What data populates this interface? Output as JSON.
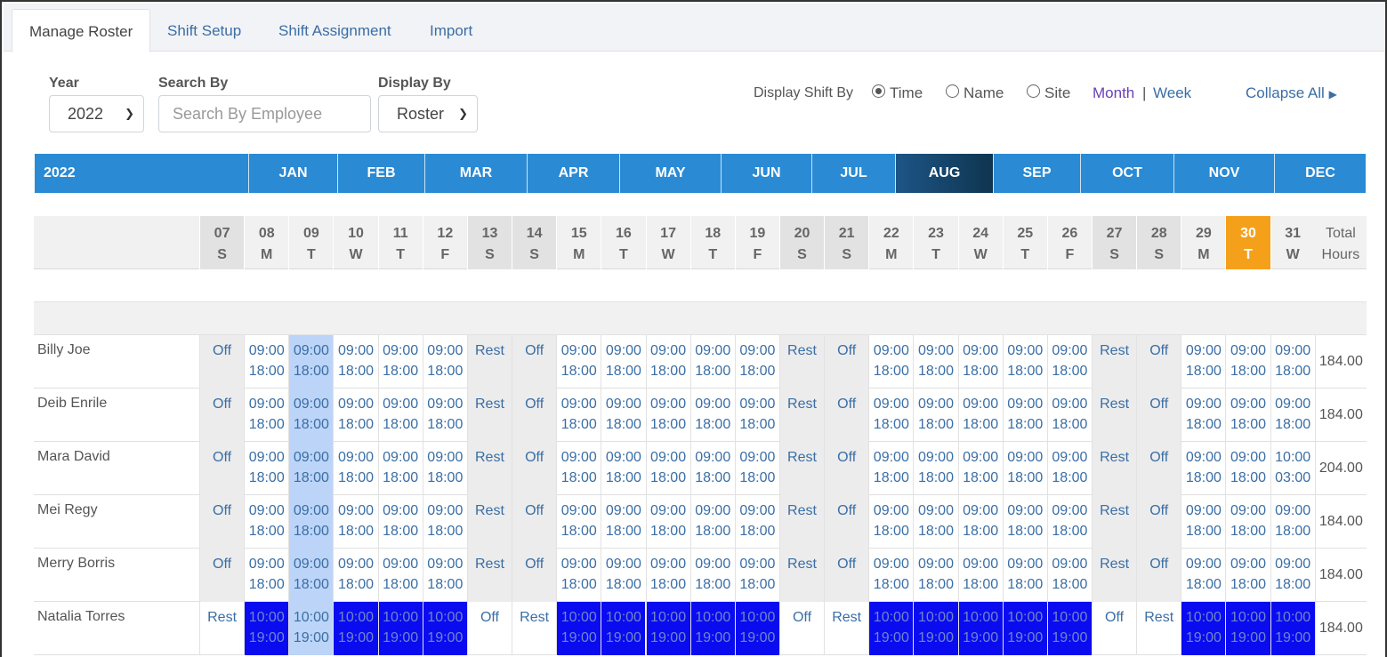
{
  "tabs": [
    {
      "label": "Manage Roster",
      "active": true
    },
    {
      "label": "Shift Setup",
      "active": false
    },
    {
      "label": "Shift Assignment",
      "active": false
    },
    {
      "label": "Import",
      "active": false
    }
  ],
  "filters": {
    "year_label": "Year",
    "year_value": "2022",
    "search_label": "Search By",
    "search_placeholder": "Search By Employee",
    "display_label": "Display By",
    "display_value": "Roster"
  },
  "display_shift": {
    "label": "Display Shift By",
    "options": [
      {
        "label": "Time",
        "checked": true
      },
      {
        "label": "Name",
        "checked": false
      },
      {
        "label": "Site",
        "checked": false
      }
    ],
    "month_link": "Month",
    "separator": "|",
    "week_link": "Week",
    "collapse_label": "Collapse All",
    "collapse_icon": "caret-right-icon"
  },
  "months": {
    "year": "2022",
    "items": [
      "JAN",
      "FEB",
      "MAR",
      "APR",
      "MAY",
      "JUN",
      "JUL",
      "AUG",
      "SEP",
      "OCT",
      "NOV",
      "DEC"
    ],
    "active": "AUG"
  },
  "days": [
    {
      "n": "07",
      "d": "S",
      "we": true
    },
    {
      "n": "08",
      "d": "M"
    },
    {
      "n": "09",
      "d": "T"
    },
    {
      "n": "10",
      "d": "W"
    },
    {
      "n": "11",
      "d": "T"
    },
    {
      "n": "12",
      "d": "F"
    },
    {
      "n": "13",
      "d": "S",
      "we": true
    },
    {
      "n": "14",
      "d": "S",
      "we": true
    },
    {
      "n": "15",
      "d": "M"
    },
    {
      "n": "16",
      "d": "T"
    },
    {
      "n": "17",
      "d": "W"
    },
    {
      "n": "18",
      "d": "T"
    },
    {
      "n": "19",
      "d": "F"
    },
    {
      "n": "20",
      "d": "S",
      "we": true
    },
    {
      "n": "21",
      "d": "S",
      "we": true
    },
    {
      "n": "22",
      "d": "M"
    },
    {
      "n": "23",
      "d": "T"
    },
    {
      "n": "24",
      "d": "W"
    },
    {
      "n": "25",
      "d": "T"
    },
    {
      "n": "26",
      "d": "F"
    },
    {
      "n": "27",
      "d": "S",
      "we": true
    },
    {
      "n": "28",
      "d": "S",
      "we": true
    },
    {
      "n": "29",
      "d": "M"
    },
    {
      "n": "30",
      "d": "T",
      "today": true
    },
    {
      "n": "31",
      "d": "W"
    }
  ],
  "total_header": [
    "Total",
    "Hours"
  ],
  "employees": [
    {
      "name": "Billy Joe",
      "total": "184.00",
      "cells": [
        "Off",
        "09:00 18:00",
        "09:00 18:00",
        "09:00 18:00",
        "09:00 18:00",
        "09:00 18:00",
        "Rest",
        "Off",
        "09:00 18:00",
        "09:00 18:00",
        "09:00 18:00",
        "09:00 18:00",
        "09:00 18:00",
        "Rest",
        "Off",
        "09:00 18:00",
        "09:00 18:00",
        "09:00 18:00",
        "09:00 18:00",
        "09:00 18:00",
        "Rest",
        "Off",
        "09:00 18:00",
        "09:00 18:00",
        "09:00 18:00"
      ]
    },
    {
      "name": "Deib Enrile",
      "total": "184.00",
      "cells": [
        "Off",
        "09:00 18:00",
        "09:00 18:00",
        "09:00 18:00",
        "09:00 18:00",
        "09:00 18:00",
        "Rest",
        "Off",
        "09:00 18:00",
        "09:00 18:00",
        "09:00 18:00",
        "09:00 18:00",
        "09:00 18:00",
        "Rest",
        "Off",
        "09:00 18:00",
        "09:00 18:00",
        "09:00 18:00",
        "09:00 18:00",
        "09:00 18:00",
        "Rest",
        "Off",
        "09:00 18:00",
        "09:00 18:00",
        "09:00 18:00"
      ]
    },
    {
      "name": "Mara David",
      "total": "204.00",
      "cells": [
        "Off",
        "09:00 18:00",
        "09:00 18:00",
        "09:00 18:00",
        "09:00 18:00",
        "09:00 18:00",
        "Rest",
        "Off",
        "09:00 18:00",
        "09:00 18:00",
        "09:00 18:00",
        "09:00 18:00",
        "09:00 18:00",
        "Rest",
        "Off",
        "09:00 18:00",
        "09:00 18:00",
        "09:00 18:00",
        "09:00 18:00",
        "09:00 18:00",
        "Rest",
        "Off",
        "09:00 18:00",
        "09:00 18:00",
        "10:00 03:00"
      ]
    },
    {
      "name": "Mei Regy",
      "total": "184.00",
      "cells": [
        "Off",
        "09:00 18:00",
        "09:00 18:00",
        "09:00 18:00",
        "09:00 18:00",
        "09:00 18:00",
        "Rest",
        "Off",
        "09:00 18:00",
        "09:00 18:00",
        "09:00 18:00",
        "09:00 18:00",
        "09:00 18:00",
        "Rest",
        "Off",
        "09:00 18:00",
        "09:00 18:00",
        "09:00 18:00",
        "09:00 18:00",
        "09:00 18:00",
        "Rest",
        "Off",
        "09:00 18:00",
        "09:00 18:00",
        "09:00 18:00"
      ]
    },
    {
      "name": "Merry Borris",
      "total": "184.00",
      "cells": [
        "Off",
        "09:00 18:00",
        "09:00 18:00",
        "09:00 18:00",
        "09:00 18:00",
        "09:00 18:00",
        "Rest",
        "Off",
        "09:00 18:00",
        "09:00 18:00",
        "09:00 18:00",
        "09:00 18:00",
        "09:00 18:00",
        "Rest",
        "Off",
        "09:00 18:00",
        "09:00 18:00",
        "09:00 18:00",
        "09:00 18:00",
        "09:00 18:00",
        "Rest",
        "Off",
        "09:00 18:00",
        "09:00 18:00",
        "09:00 18:00"
      ]
    },
    {
      "name": "Natalia Torres",
      "total": "184.00",
      "blue": true,
      "cells": [
        "Rest",
        "10:00 19:00",
        "10:00 19:00",
        "10:00 19:00",
        "10:00 19:00",
        "10:00 19:00",
        "Off",
        "Rest",
        "10:00 19:00",
        "10:00 19:00",
        "10:00 19:00",
        "10:00 19:00",
        "10:00 19:00",
        "Off",
        "Rest",
        "10:00 19:00",
        "10:00 19:00",
        "10:00 19:00",
        "10:00 19:00",
        "10:00 19:00",
        "Off",
        "Rest",
        "10:00 19:00",
        "10:00 19:00",
        "10:00 19:00"
      ]
    }
  ],
  "colors": {
    "month_bar": "#2a8ad4",
    "active_month": "#0f3550",
    "today": "#f5a01a",
    "selected_day": "#bcd4f7",
    "special_shift": "#0b0bf0",
    "link": "#3a6ea5"
  }
}
